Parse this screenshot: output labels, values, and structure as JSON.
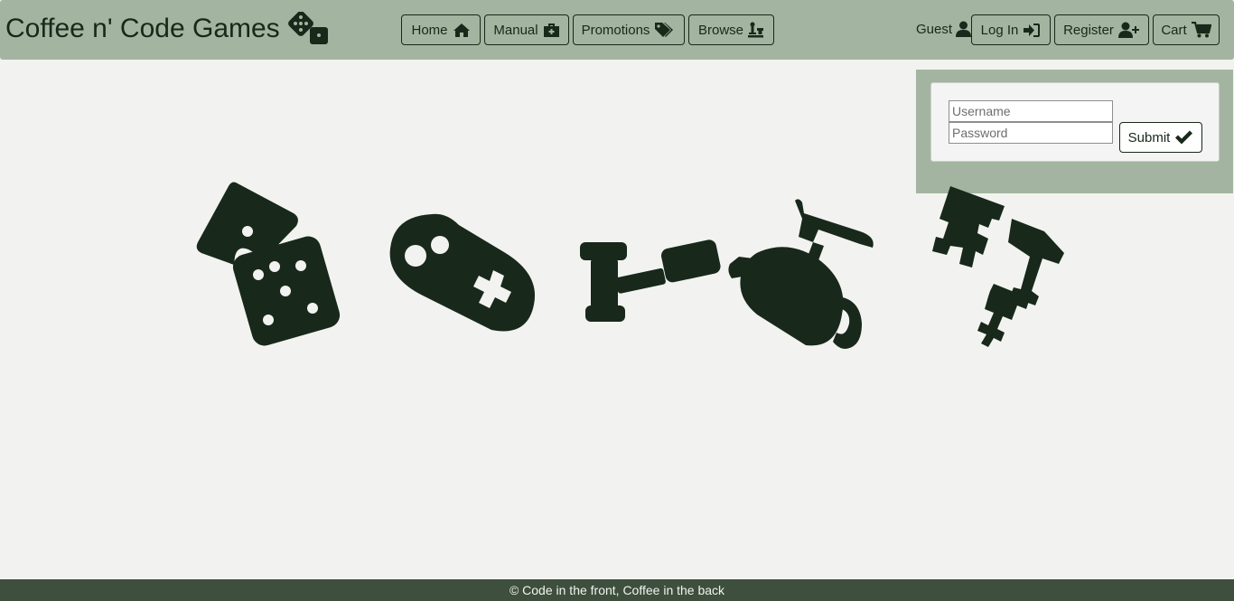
{
  "header": {
    "brand": "Coffee n' Code Games",
    "brand_icon": "dice-icon"
  },
  "nav": [
    {
      "label": "Home",
      "icon": "home-icon"
    },
    {
      "label": "Manual",
      "icon": "first-aid-kit-icon"
    },
    {
      "label": "Promotions",
      "icon": "tags-icon"
    },
    {
      "label": "Browse",
      "icon": "chess-icon"
    }
  ],
  "account": {
    "guest_label": "Guest",
    "guest_icon": "user-icon",
    "login_label": "Log In",
    "login_icon": "sign-in-icon",
    "register_label": "Register",
    "register_icon": "user-plus-icon",
    "cart_label": "Cart",
    "cart_icon": "shopping-cart-icon"
  },
  "login_form": {
    "username_placeholder": "Username",
    "username_value": "",
    "password_placeholder": "Password",
    "password_value": "",
    "submit_label": "Submit",
    "submit_icon": "check-icon"
  },
  "hero_icons": [
    "dice-icon",
    "gamepad-icon",
    "gavel-icon",
    "fire-extinguisher-icon",
    "chess-pieces-icon"
  ],
  "footer": {
    "text": "© Code in the front, Coffee in the back"
  },
  "colors": {
    "nav_bg": "#a3b5a0",
    "dark": "#18281a",
    "page_bg": "#f2f3f1",
    "footer_bg": "#3e4f3d"
  }
}
